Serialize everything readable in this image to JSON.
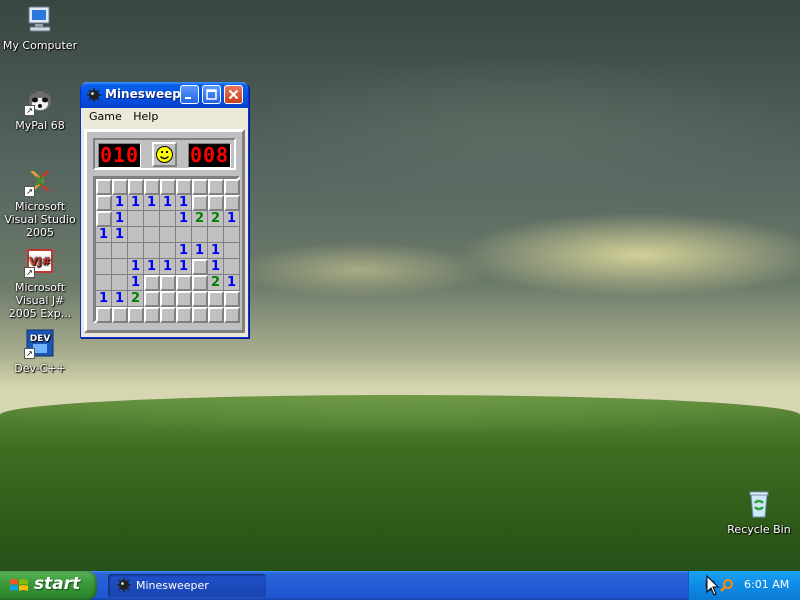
{
  "desktop": {
    "icons": [
      {
        "label": "My Computer",
        "icon": "computer-icon"
      },
      {
        "label": "MyPal 68",
        "icon": "mypal-icon"
      },
      {
        "label": "Microsoft Visual Studio 2005",
        "icon": "visual-studio-icon"
      },
      {
        "label": "Microsoft Visual J# 2005 Exp...",
        "icon": "vjsharp-icon"
      },
      {
        "label": "Dev-C++",
        "icon": "devcpp-icon"
      },
      {
        "label": "Recycle Bin",
        "icon": "recycle-bin-icon"
      }
    ],
    "shortcut_glyph": "↗"
  },
  "minesweeper": {
    "title": "Minesweeper",
    "title_display": "Minesweep...",
    "menu": {
      "game": "Game",
      "help": "Help"
    },
    "mine_counter": "010",
    "timer": "008",
    "smiley": "smiley-face-icon",
    "grid": [
      [
        "",
        "",
        "",
        "",
        "",
        "",
        "",
        "",
        ""
      ],
      [
        "",
        "1",
        "1",
        "1",
        "1",
        "1",
        "",
        "",
        ""
      ],
      [
        "",
        "1",
        " ",
        " ",
        " ",
        "1",
        "2",
        "2",
        "1"
      ],
      [
        "1",
        "1",
        " ",
        " ",
        " ",
        " ",
        " ",
        " ",
        " "
      ],
      [
        " ",
        " ",
        " ",
        " ",
        " ",
        "1",
        "1",
        "1",
        " "
      ],
      [
        " ",
        " ",
        "1",
        "1",
        "1",
        "1",
        "",
        "1",
        " "
      ],
      [
        " ",
        " ",
        "1",
        "",
        "",
        "",
        "",
        "2",
        "1"
      ],
      [
        "1",
        "1",
        "2",
        "",
        "",
        "",
        "",
        "",
        ""
      ],
      [
        "",
        "",
        "",
        "",
        "",
        "",
        "",
        "",
        ""
      ]
    ],
    "colors": {
      "n1": "#0000ff",
      "n2": "#008000"
    }
  },
  "taskbar": {
    "start_label": "start",
    "tasks": [
      {
        "label": "Minesweeper",
        "icon": "minesweeper-icon"
      }
    ],
    "tray": {
      "clock": "6:01 AM"
    }
  }
}
